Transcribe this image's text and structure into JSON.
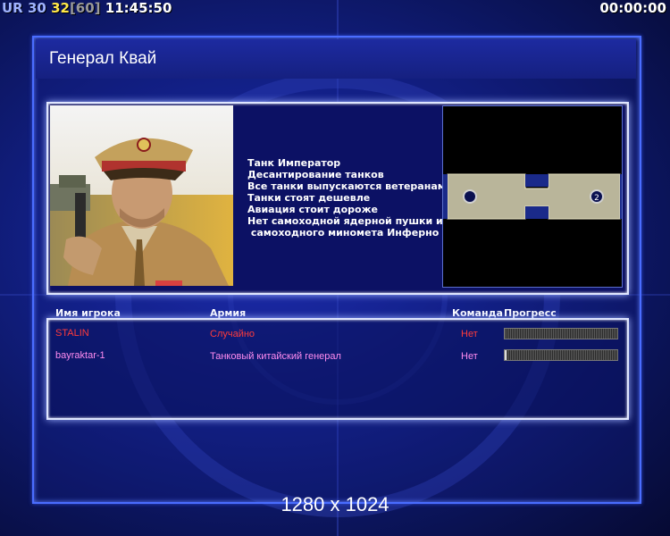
{
  "hud": {
    "prefix": "UR",
    "fps": "30",
    "frame": "32",
    "frame_max": "[60]",
    "clock": "11:45:50",
    "timer": "00:00:00"
  },
  "title": "Генерал Квай",
  "general": {
    "traits": [
      "Танк Император",
      "Десантирование танков",
      "Все танки выпускаются ветеранами",
      "Танки стоят дешевле",
      "Авиация стоит дороже",
      "Нет самоходной ядерной пушки и",
      " самоходного миномета Инферно"
    ]
  },
  "minimap": {
    "start_positions": [
      "1",
      "2"
    ]
  },
  "players": {
    "headers": {
      "name": "Имя игрока",
      "army": "Армия",
      "team": "Команда",
      "progress": "Прогресс"
    },
    "rows": [
      {
        "name": "STALIN",
        "army": "Случайно",
        "team": "Нет",
        "progress": 0.0,
        "name_color": "#ff3b3b",
        "army_color": "#ff3b3b",
        "team_color": "#ff3b3b"
      },
      {
        "name": "bayraktar-1",
        "army": "Танковый китайский генерал",
        "team": "Нет",
        "progress": 0.01,
        "name_color": "#ff8cf0",
        "army_color": "#ff8cf0",
        "team_color": "#ff8cf0"
      }
    ]
  },
  "resolution": "1280 x 1024",
  "colors": {
    "frame": "#4a6dff",
    "panel_border": "#dfe6ff",
    "background": "#13218a"
  }
}
